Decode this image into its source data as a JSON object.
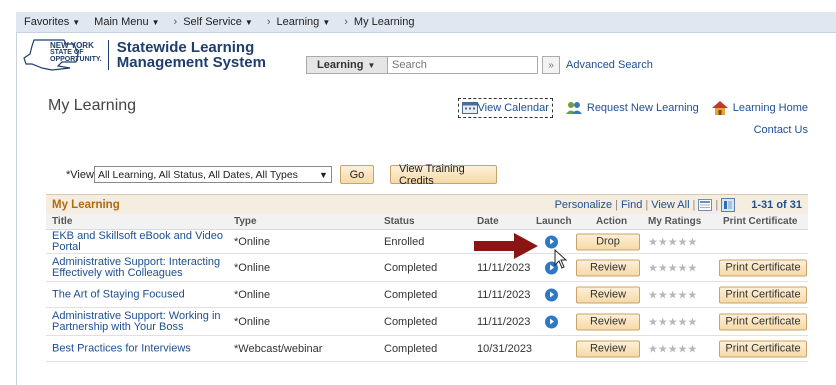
{
  "nav": {
    "items": [
      {
        "label": "Favorites",
        "caret": true
      },
      {
        "label": "Main Menu",
        "caret": true
      },
      {
        "label": "Self Service",
        "caret": true,
        "sep": true
      },
      {
        "label": "Learning",
        "caret": true
      },
      {
        "label": "My Learning",
        "caret": false,
        "sep": true
      }
    ]
  },
  "brand": {
    "state_line1": "NEW YORK",
    "state_line2": "STATE OF",
    "state_line3": "OPPORTUNITY.",
    "title_line1": "Statewide Learning",
    "title_line2": "Management System"
  },
  "search": {
    "scope": "Learning",
    "placeholder": "Search",
    "go_glyph": "»",
    "advanced": "Advanced Search"
  },
  "page": {
    "title": "My Learning",
    "view_calendar": "View Calendar",
    "request_new": "Request New Learning",
    "learning_home": "Learning Home",
    "contact": "Contact Us"
  },
  "filter": {
    "label": "*View",
    "value": "All Learning, All Status, All Dates, All Types",
    "go": "Go",
    "credits": "View Training Credits"
  },
  "grid": {
    "caption": "My Learning",
    "personalize": "Personalize",
    "find": "Find",
    "view_all": "View All",
    "count": "1-31 of 31",
    "columns": {
      "title": "Title",
      "type": "Type",
      "status": "Status",
      "date": "Date",
      "launch": "Launch",
      "action": "Action",
      "ratings": "My Ratings",
      "certificate": "Print Certificate"
    },
    "rows": [
      {
        "title": "EKB and Skillsoft eBook and Video Portal",
        "type": "*Online",
        "status": "Enrolled",
        "date": "",
        "action": "Drop",
        "stars": "★★★★★",
        "certificate": ""
      },
      {
        "title": "Administrative Support: Interacting Effectively with Colleagues",
        "type": "*Online",
        "status": "Completed",
        "date": "11/11/2023",
        "action": "Review",
        "stars": "★★★★★",
        "certificate": "Print Certificate"
      },
      {
        "title": "The Art of Staying Focused",
        "type": "*Online",
        "status": "Completed",
        "date": "11/11/2023",
        "action": "Review",
        "stars": "★★★★★",
        "certificate": "Print Certificate"
      },
      {
        "title": "Administrative Support: Working in Partnership with Your Boss",
        "type": "*Online",
        "status": "Completed",
        "date": "11/11/2023",
        "action": "Review",
        "stars": "★★★★★",
        "certificate": "Print Certificate"
      },
      {
        "title": "Best Practices for Interviews",
        "type": "*Webcast/webinar",
        "status": "Completed",
        "date": "10/31/2023",
        "action": "Review",
        "stars": "★★★★★",
        "certificate": "Print Certificate"
      }
    ]
  },
  "colors": {
    "nav_bg": "#dfe8f1",
    "link": "#1d4f91",
    "caption": "#b06a13",
    "button": "#f6d9a7",
    "arrow": "#8b1414"
  }
}
